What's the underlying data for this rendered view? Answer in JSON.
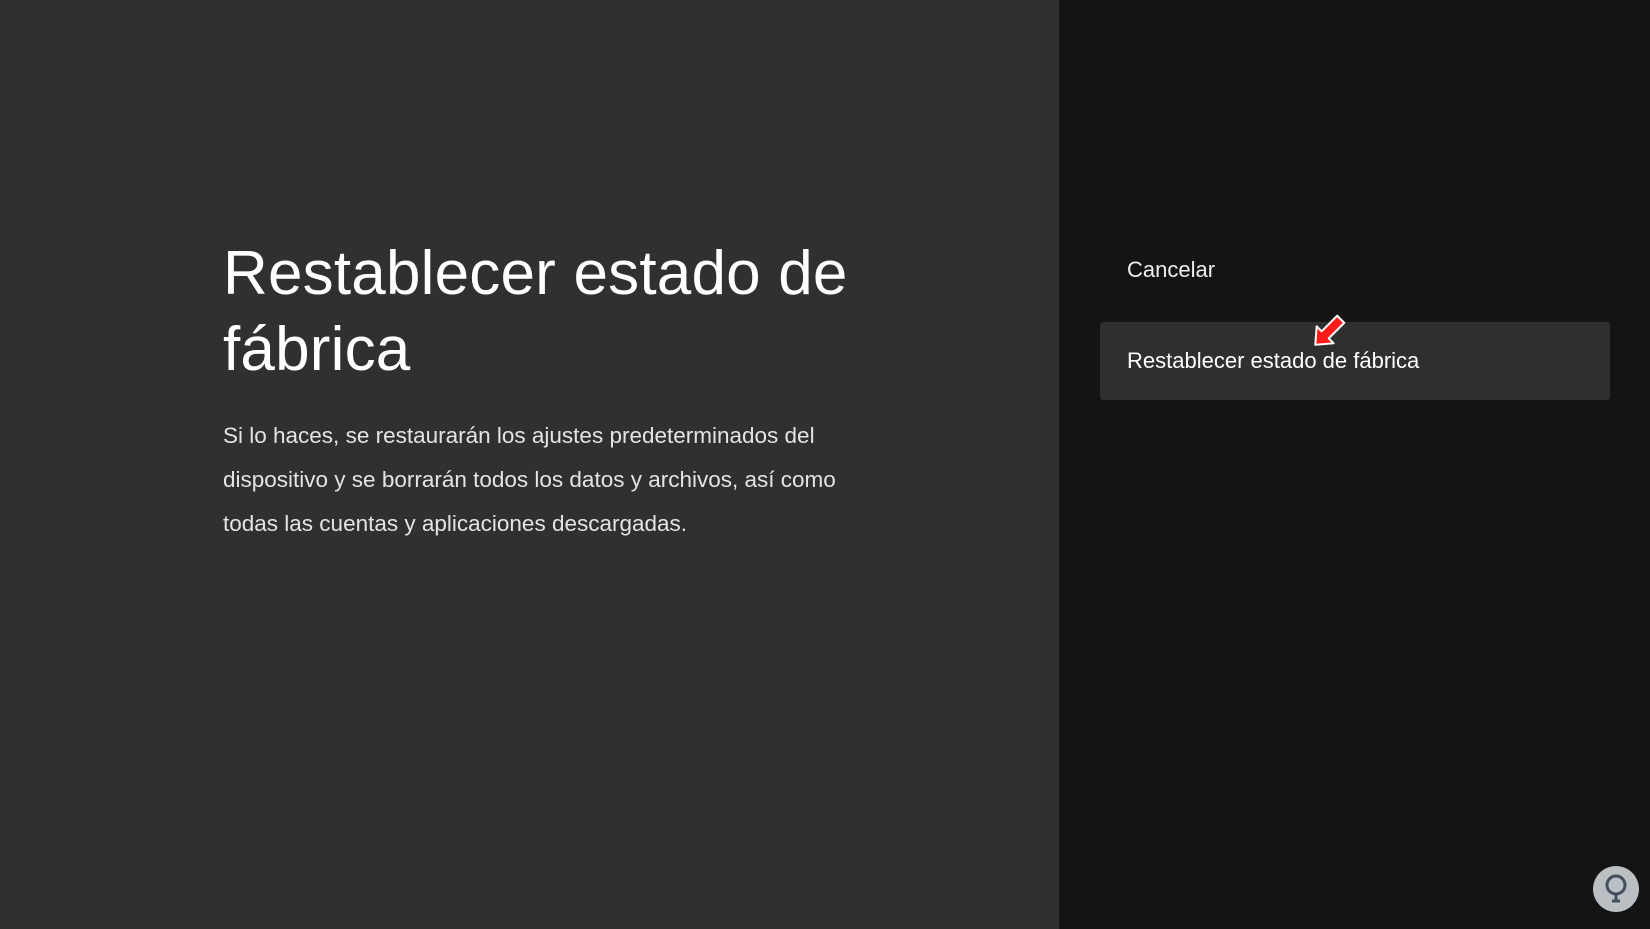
{
  "dialog": {
    "title": "Restablecer estado de fábrica",
    "description": "Si lo haces, se restaurarán los ajustes predeterminados del dispositivo y se borrarán todos los datos y archivos, así como todas las cuentas y aplicaciones descargadas."
  },
  "actions": {
    "cancel_label": "Cancelar",
    "confirm_label": "Restablecer estado de fábrica"
  },
  "annotation": {
    "icon": "arrow-pointer-icon",
    "color": "#ff1a1a"
  },
  "watermark": {
    "icon": "site-logo-icon"
  },
  "colors": {
    "info_panel_bg": "#303030",
    "actions_panel_bg": "#141414",
    "focused_action_bg": "#2f2f2f"
  }
}
